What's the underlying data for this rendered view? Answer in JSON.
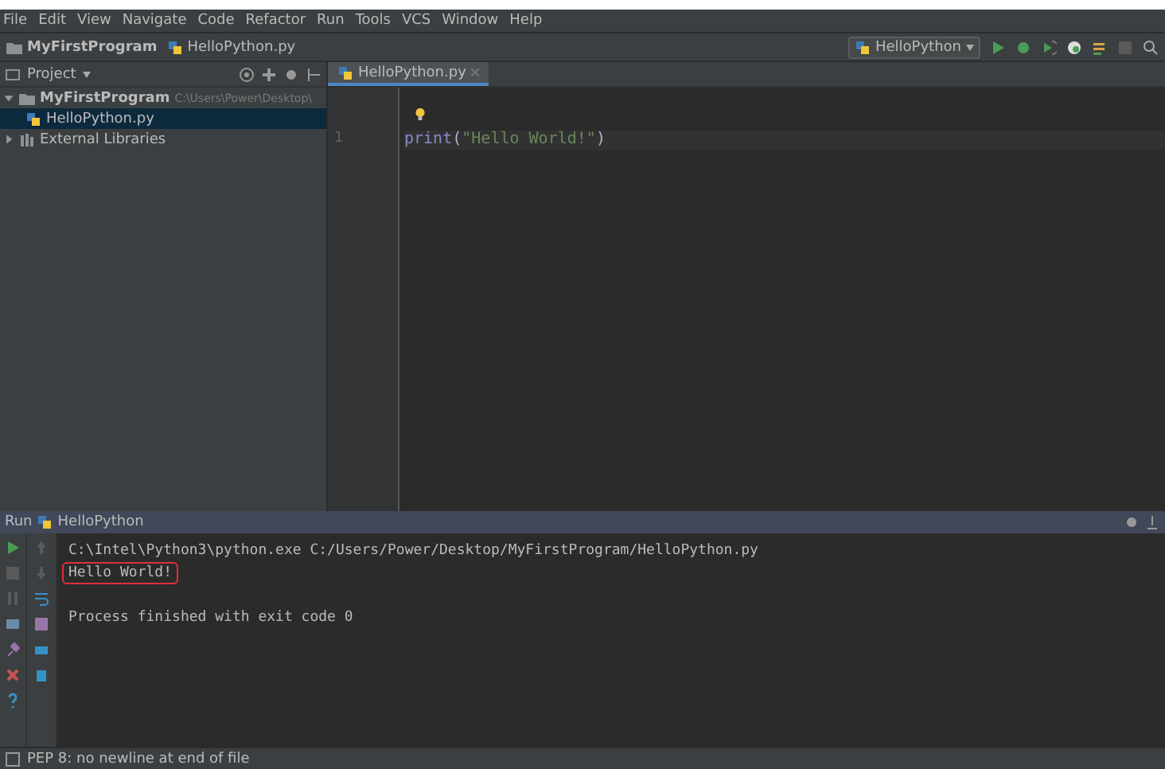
{
  "menu": [
    "File",
    "Edit",
    "View",
    "Navigate",
    "Code",
    "Refactor",
    "Run",
    "Tools",
    "VCS",
    "Window",
    "Help"
  ],
  "navbar": {
    "crumbs": [
      "MyFirstProgram",
      "HelloPython.py"
    ],
    "run_config": "HelloPython"
  },
  "project": {
    "title": "Project",
    "tree": [
      {
        "name": "MyFirstProgram",
        "path": "C:\\Users\\Power\\Desktop\\",
        "kind": "folder",
        "expanded": true,
        "selected": false,
        "children": [
          {
            "name": "HelloPython.py",
            "kind": "python",
            "selected": true
          }
        ]
      },
      {
        "name": "External Libraries",
        "kind": "library",
        "expanded": false,
        "selected": false
      }
    ]
  },
  "editor": {
    "tabs": [
      {
        "label": "HelloPython.py",
        "selected": true
      }
    ],
    "lines": [
      {
        "number": "1",
        "func": "print",
        "open": "(",
        "string": "\"Hello World!\"",
        "close": ")"
      }
    ]
  },
  "run": {
    "label": "Run",
    "config": "HelloPython",
    "output": [
      {
        "lines": [
          {
            "text": "C:\\Intel\\Python3\\python.exe C:/Users/Power/Desktop/MyFirstProgram/HelloPython.py",
            "highlighted": false
          },
          {
            "text": "Hello World!",
            "highlighted": true
          }
        ]
      },
      {
        "lines": [
          {
            "text": "Process finished with exit code 0",
            "highlighted": false
          }
        ]
      }
    ]
  },
  "status_bar": {
    "message": "PEP 8: no newline at end of file"
  }
}
